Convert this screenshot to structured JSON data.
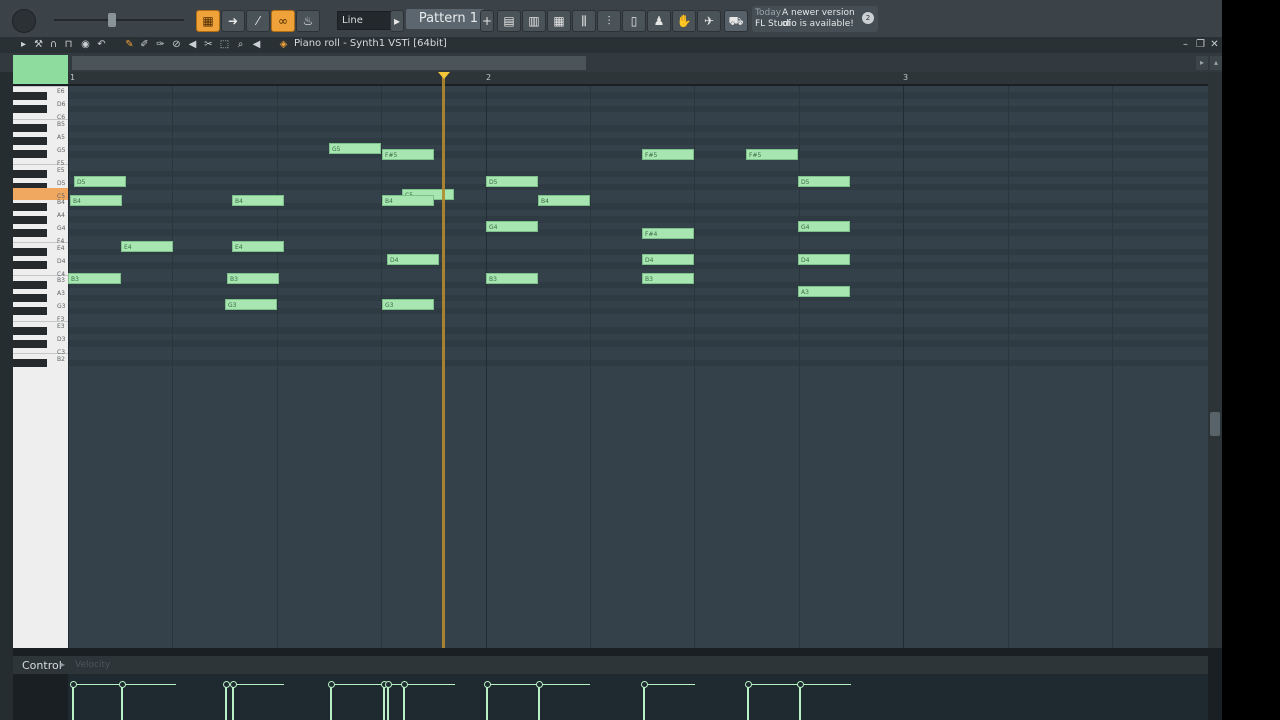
{
  "toolbar": {
    "line_mode": "Line",
    "pattern": "Pattern 1",
    "news_date": "Today",
    "news_line1": "A newer version of",
    "news_line2": "FL Studio is available!",
    "news_badge": "2"
  },
  "piano_roll": {
    "title": "Piano roll - Synth1 VSTi [64bit]",
    "bars": [
      "1",
      "2",
      "3"
    ],
    "keys": [
      "E6",
      "D6",
      "C6",
      "B5",
      "A5",
      "G5",
      "F5",
      "E5",
      "D5",
      "C5",
      "B4",
      "A4",
      "G4",
      "F4",
      "E4",
      "D4",
      "C4",
      "B3",
      "A3",
      "G3",
      "F3",
      "E3",
      "D3",
      "C3",
      "B2"
    ],
    "notes": [
      {
        "label": "G5"
      },
      {
        "label": "F#5"
      },
      {
        "label": "F#5"
      },
      {
        "label": "F#5"
      },
      {
        "label": "D5"
      },
      {
        "label": "D5"
      },
      {
        "label": "D5"
      },
      {
        "label": "C5"
      },
      {
        "label": "B4"
      },
      {
        "label": "B4"
      },
      {
        "label": "B4"
      },
      {
        "label": "B4"
      },
      {
        "label": "G4"
      },
      {
        "label": "G4"
      },
      {
        "label": "F#4"
      },
      {
        "label": "E4"
      },
      {
        "label": "E4"
      },
      {
        "label": "D4"
      },
      {
        "label": "D4"
      },
      {
        "label": "D4"
      },
      {
        "label": "B3"
      },
      {
        "label": "B3"
      },
      {
        "label": "B3"
      },
      {
        "label": "B3"
      },
      {
        "label": "A3"
      },
      {
        "label": "G3"
      },
      {
        "label": "G3"
      }
    ]
  },
  "control": {
    "label": "Control",
    "target": "Velocity"
  },
  "colors": {
    "accent": "#f0a23a",
    "note": "#a7e6b0",
    "playhead": "#f4c63a",
    "grid": "#34414a"
  },
  "icons": [
    "master-volume-knob-icon",
    "snap-icon",
    "draw-icon",
    "paint-icon",
    "delete-icon",
    "mute-icon",
    "slice-icon",
    "select-icon",
    "zoom-icon",
    "playback-icon",
    "arrow-icon",
    "link-icon",
    "stamp-icon",
    "mixer-icon",
    "channel-rack-icon",
    "browser-icon",
    "plugin-icon",
    "cart-icon",
    "globe-icon"
  ]
}
